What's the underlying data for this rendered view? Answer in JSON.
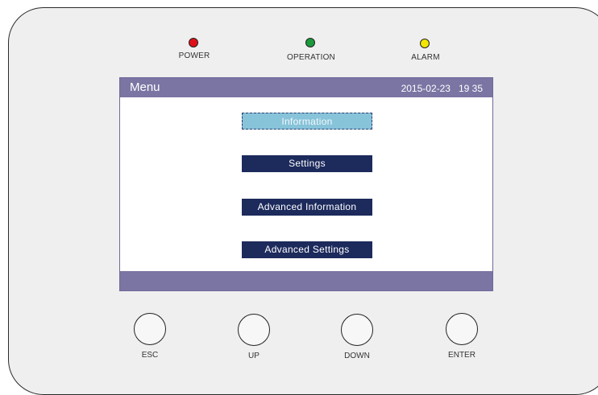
{
  "indicators": [
    {
      "label": "POWER",
      "color": "#e0101a"
    },
    {
      "label": "OPERATION",
      "color": "#1a9a3a"
    },
    {
      "label": "ALARM",
      "color": "#f2e600"
    }
  ],
  "screen": {
    "title": "Menu",
    "datetime": "2015-02-23   19 35",
    "header_color": "#7a75a3",
    "menu_items": [
      {
        "label": "Information",
        "selected": true
      },
      {
        "label": "Settings",
        "selected": false
      },
      {
        "label": "Advanced Information",
        "selected": false
      },
      {
        "label": "Advanced Settings",
        "selected": false
      }
    ]
  },
  "buttons": [
    {
      "label": "ESC"
    },
    {
      "label": "UP"
    },
    {
      "label": "DOWN"
    },
    {
      "label": "ENTER"
    }
  ]
}
